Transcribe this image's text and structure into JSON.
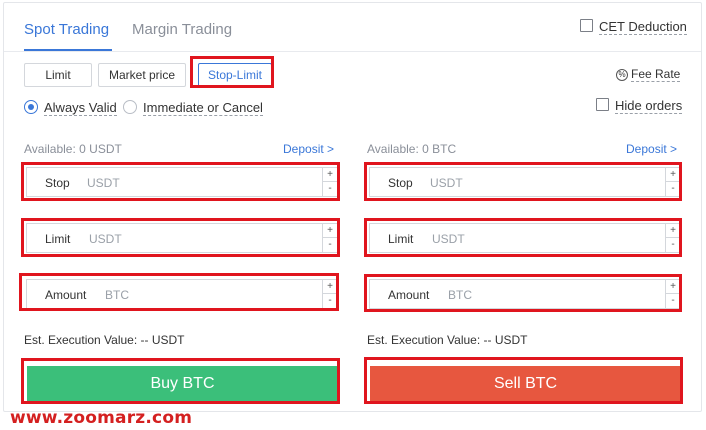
{
  "tabs": [
    {
      "label": "Spot Trading",
      "active": true
    },
    {
      "label": "Margin Trading",
      "active": false
    }
  ],
  "cet_deduction": {
    "label": "CET Deduction",
    "checked": false
  },
  "order_types": [
    {
      "label": "Limit",
      "selected": false
    },
    {
      "label": "Market price",
      "selected": false
    },
    {
      "label": "Stop-Limit",
      "selected": true
    }
  ],
  "fee_rate": {
    "label": "Fee Rate",
    "icon": "percent-icon"
  },
  "validity": [
    {
      "label": "Always Valid",
      "selected": true
    },
    {
      "label": "Immediate or Cancel",
      "selected": false
    }
  ],
  "hide_orders": {
    "label": "Hide orders",
    "checked": false
  },
  "buy": {
    "available": "Available: 0 USDT",
    "deposit": "Deposit >",
    "fields": [
      {
        "label": "Stop",
        "unit": "USDT",
        "plus": "+",
        "minus": "-"
      },
      {
        "label": "Limit",
        "unit": "USDT",
        "plus": "+",
        "minus": "-"
      },
      {
        "label": "Amount",
        "unit": "BTC",
        "plus": "+",
        "minus": "-"
      }
    ],
    "est": "Est. Execution Value: -- USDT",
    "button": "Buy BTC"
  },
  "sell": {
    "available": "Available: 0 BTC",
    "deposit": "Deposit >",
    "fields": [
      {
        "label": "Stop",
        "unit": "USDT",
        "plus": "+",
        "minus": "-"
      },
      {
        "label": "Limit",
        "unit": "USDT",
        "plus": "+",
        "minus": "-"
      },
      {
        "label": "Amount",
        "unit": "BTC",
        "plus": "+",
        "minus": "-"
      }
    ],
    "est": "Est. Execution Value: -- USDT",
    "button": "Sell BTC"
  },
  "colors": {
    "accent": "#3a77d8",
    "buy": "#3bbf7a",
    "sell": "#e7573f",
    "highlight": "#e0151e"
  },
  "watermark": "www.zoomarz.com"
}
